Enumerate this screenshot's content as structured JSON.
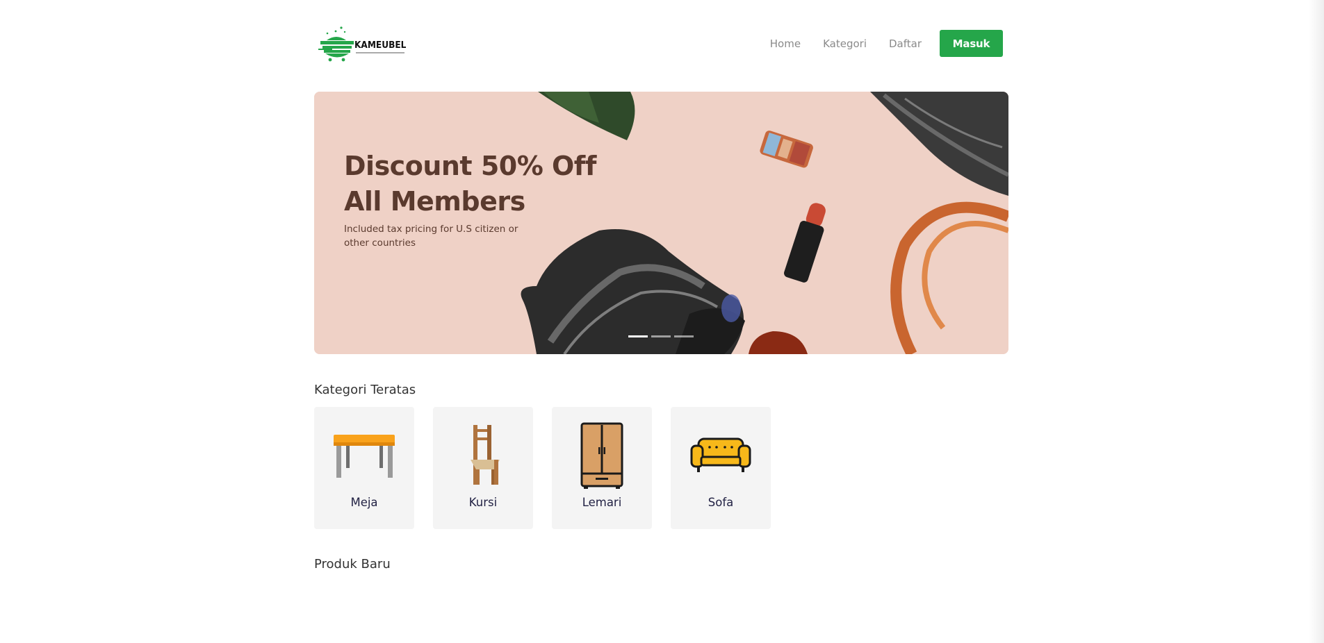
{
  "brand": {
    "name": "KAMEUBEL",
    "logo_color": "#25a64a"
  },
  "nav": {
    "links": [
      {
        "label": "Home"
      },
      {
        "label": "Kategori"
      },
      {
        "label": "Daftar"
      }
    ],
    "login_label": "Masuk"
  },
  "banner": {
    "title_line1": "Discount 50% Off",
    "title_line2": "All Members",
    "subtitle": "Included tax pricing for U.S citizen or other countries",
    "slides": 3,
    "active_slide": 1
  },
  "kategori": {
    "title": "Kategori Teratas",
    "items": [
      {
        "label": "Meja",
        "icon": "table-icon"
      },
      {
        "label": "Kursi",
        "icon": "chair-icon"
      },
      {
        "label": "Lemari",
        "icon": "wardrobe-icon"
      },
      {
        "label": "Sofa",
        "icon": "sofa-icon"
      }
    ]
  },
  "produk": {
    "title": "Produk Baru"
  },
  "colors": {
    "accent": "#25a64a",
    "banner_bg": "#efd1c6",
    "banner_text": "#5a3a2e",
    "card_bg": "#f4f4f4"
  }
}
